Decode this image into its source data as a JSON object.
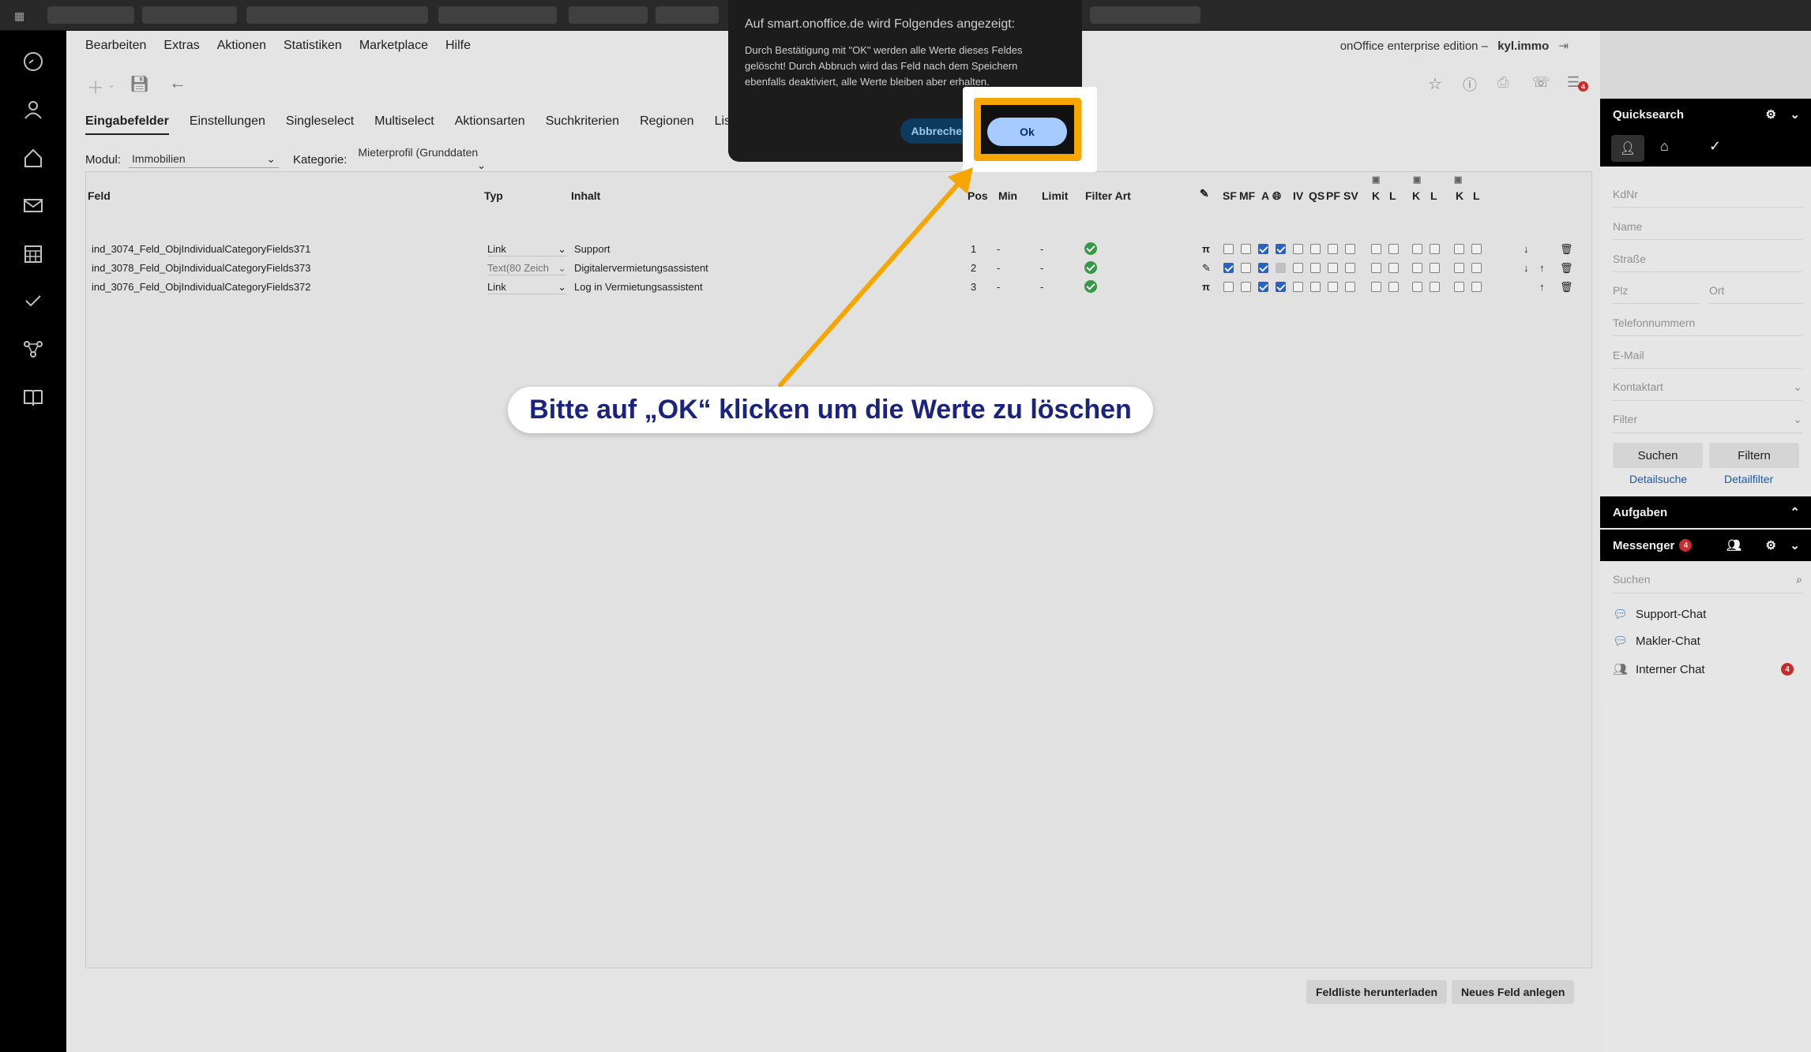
{
  "menu": [
    "Bearbeiten",
    "Extras",
    "Aktionen",
    "Statistiken",
    "Marketplace",
    "Hilfe"
  ],
  "brand": {
    "edition": "onOffice enterprise edition",
    "sep": "–",
    "user": "kyl.immo"
  },
  "notification_count": "4",
  "tabs": [
    "Eingabefelder",
    "Einstellungen",
    "Singleselect",
    "Multiselect",
    "Aktionsarten",
    "Suchkriterien",
    "Regionen",
    "Liste"
  ],
  "filters": {
    "modul_label": "Modul:",
    "modul_value": "Immobilien",
    "kategorie_label": "Kategorie:",
    "kategorie_value": "Mieterprofil (Grunddaten"
  },
  "table": {
    "headers": {
      "feld": "Feld",
      "typ": "Typ",
      "inhalt": "Inhalt",
      "pos": "Pos",
      "min": "Min",
      "limit": "Limit",
      "filter": "Filter Art",
      "sf": "SF",
      "mf": "MF",
      "a": "A",
      "iv": "IV",
      "qs": "QS",
      "pf": "PF",
      "sv": "SV",
      "k1": "K",
      "l1": "L",
      "k2": "K",
      "l2": "L",
      "k3": "K",
      "l3": "L"
    },
    "rows": [
      {
        "feld": "ind_3074_Feld_ObjIndividualCategoryFields371",
        "typ": "Link",
        "inhalt": "Support",
        "pos": "1",
        "min": "-",
        "limit": "-"
      },
      {
        "feld": "ind_3078_Feld_ObjIndividualCategoryFields373",
        "typ": "Text(80 Zeich",
        "inhalt": "Digitalervermietungsassistent",
        "pos": "2",
        "min": "-",
        "limit": "-"
      },
      {
        "feld": "ind_3076_Feld_ObjIndividualCategoryFields372",
        "typ": "Link",
        "inhalt": "Log in Vermietungsassistent",
        "pos": "3",
        "min": "-",
        "limit": "-"
      }
    ]
  },
  "buttons": {
    "download": "Feldliste herunterladen",
    "new_field": "Neues Feld anlegen"
  },
  "dialog": {
    "title": "Auf smart.onoffice.de wird Folgendes angezeigt:",
    "message": "Durch Bestätigung mit \"OK\" werden alle Werte dieses Feldes gelöscht! Durch Abbruch wird das Feld nach dem Speichern ebenfalls deaktiviert, alle Werte bleiben aber erhalten.",
    "cancel": "Abbrechen",
    "ok": "Ok"
  },
  "callout": "Bitte auf „OK“ klicken um die Werte zu löschen",
  "quicksearch": {
    "title": "Quicksearch",
    "fields": [
      "KdNr",
      "Name",
      "Straße",
      "Plz",
      "Ort",
      "Telefonnummern",
      "E-Mail",
      "Kontaktart",
      "Filter"
    ],
    "search": "Suchen",
    "filter": "Filtern",
    "detail_search": "Detailsuche",
    "detail_filter": "Detailfilter"
  },
  "aufgaben": "Aufgaben",
  "messenger": {
    "title": "Messenger",
    "badge": "4",
    "search": "Suchen",
    "chats": [
      {
        "name": "Support-Chat"
      },
      {
        "name": "Makler-Chat"
      },
      {
        "name": "Interner Chat",
        "badge": "4"
      }
    ]
  },
  "colors": {
    "accent": "#f7a600",
    "callout_text": "#1a237e",
    "ok_button": "#a8cbff"
  }
}
